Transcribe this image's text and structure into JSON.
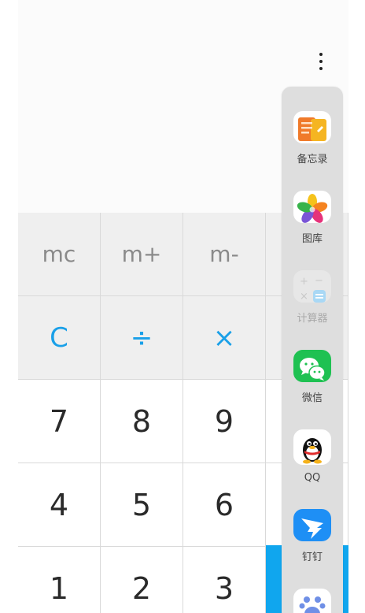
{
  "menu": {
    "icon": "more-vertical-icon"
  },
  "keypad": {
    "rows": [
      [
        {
          "label": "mc"
        },
        {
          "label": "m+"
        },
        {
          "label": "m-"
        }
      ],
      [
        {
          "label": "C"
        },
        {
          "label": "÷"
        },
        {
          "label": "×"
        }
      ],
      [
        {
          "label": "7"
        },
        {
          "label": "8"
        },
        {
          "label": "9"
        }
      ],
      [
        {
          "label": "4"
        },
        {
          "label": "5"
        },
        {
          "label": "6"
        }
      ],
      [
        {
          "label": "1"
        },
        {
          "label": "2"
        },
        {
          "label": "3"
        }
      ]
    ]
  },
  "dock": {
    "apps": [
      {
        "label": "备忘录",
        "icon": "notes-app-icon"
      },
      {
        "label": "图库",
        "icon": "gallery-app-icon"
      },
      {
        "label": "计算器",
        "icon": "calculator-app-icon"
      },
      {
        "label": "微信",
        "icon": "wechat-app-icon"
      },
      {
        "label": "QQ",
        "icon": "qq-app-icon"
      },
      {
        "label": "钉钉",
        "icon": "dingtalk-app-icon"
      },
      {
        "label": "",
        "icon": "baidu-app-icon"
      }
    ]
  },
  "colors": {
    "operator": "#1aa0e8",
    "key_grey": "#efefef",
    "accent_blue": "#10a6ee",
    "dock_bg": "#dedede"
  }
}
